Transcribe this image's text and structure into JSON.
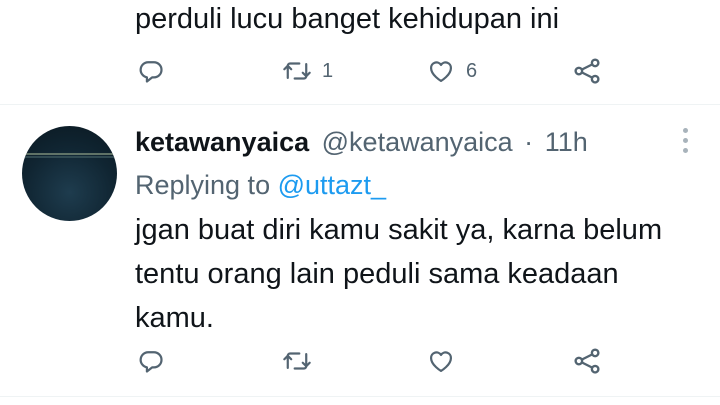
{
  "previous_tweet": {
    "text": "perduli lucu banget kehidupan ini",
    "actions": {
      "reply_count": "",
      "retweet_count": "1",
      "like_count": "6"
    }
  },
  "tweet": {
    "display_name": "ketawanyaica",
    "handle": "@ketawanyaica",
    "separator": "·",
    "time": "11h",
    "replying_prefix": "Replying to",
    "replying_to": "@uttazt_",
    "text": "jgan buat diri kamu sakit ya, karna belum tentu orang lain peduli sama keadaan kamu.",
    "actions": {
      "reply_count": "",
      "retweet_count": "",
      "like_count": ""
    }
  },
  "icons": {
    "reply": "reply-icon",
    "retweet": "retweet-icon",
    "like": "heart-icon",
    "share": "share-icon",
    "more": "more-icon"
  },
  "colors": {
    "text": "#0f1419",
    "secondary": "#536471",
    "link": "#1d9bf0",
    "divider": "#eff3f4"
  }
}
